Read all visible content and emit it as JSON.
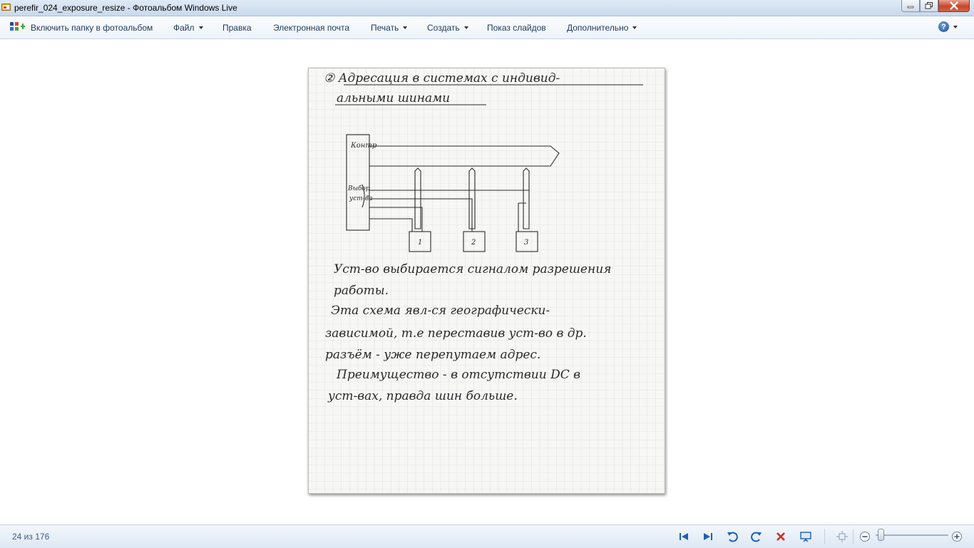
{
  "window": {
    "title": "perefir_024_exposure_resize - Фотоальбом Windows Live"
  },
  "menu": {
    "include_folder": "Включить папку в фотоальбом",
    "file": "Файл",
    "edit": "Правка",
    "email": "Электронная почта",
    "print": "Печать",
    "create": "Создать",
    "slideshow": "Показ слайдов",
    "extras": "Дополнительно",
    "help_glyph": "?"
  },
  "photo": {
    "heading_line1": "② Адресация в системах с индивид-",
    "heading_line2": "альными шинами",
    "diagram_labels": {
      "controller": "Контр",
      "select_line1": "Выбор",
      "select_line2": "уст-ва",
      "device1": "1",
      "device2": "2",
      "device3": "3"
    },
    "text_lines": [
      "Уст-во выбирается сигналом разрешения",
      "работы.",
      "Эта схема явл-ся географически-",
      "зависимой, т.е переставив уст-во в др.",
      "разъём - уже перепутаем адрес.",
      "Преимущество - в отсутствии DC в",
      "уст-вах, правда шин больше."
    ]
  },
  "status": {
    "counter": "24 из 176"
  },
  "zoom": {
    "level": 0.05
  },
  "colors": {
    "close_button": "#c7452a",
    "menu_text": "#1e395b",
    "nav_blue": "#1f5fb0",
    "delete_red": "#d12a1f"
  },
  "icons": {
    "prev": "previous-icon",
    "next": "next-icon",
    "rotate_left": "rotate-left-icon",
    "rotate_right": "rotate-right-icon",
    "delete": "delete-icon",
    "slideshow": "slideshow-icon",
    "fit": "fit-window-icon",
    "zoom_out": "zoom-out-icon",
    "zoom_in": "zoom-in-icon"
  }
}
